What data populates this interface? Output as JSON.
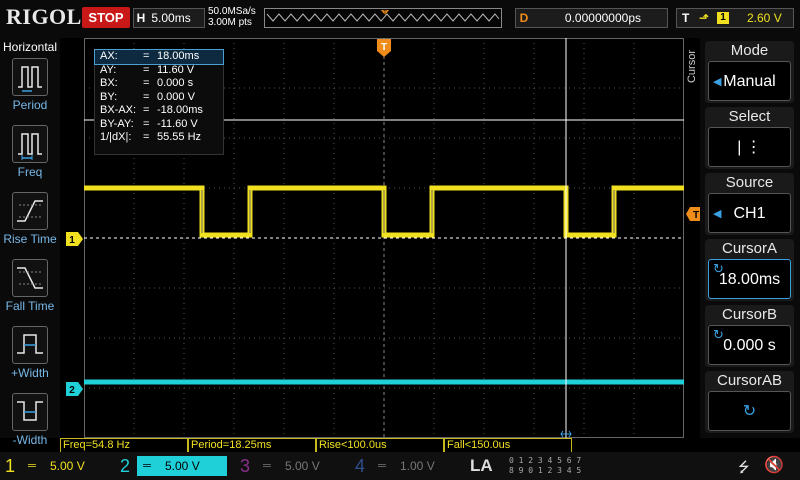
{
  "header": {
    "brand": "RIGOL",
    "run_state": "STOP",
    "timebase_label": "H",
    "timebase_value": "5.00ms",
    "sample_rate": "50.0MSa/s",
    "memory_depth": "3.00M pts",
    "delay_label": "D",
    "delay_value": "0.00000000ps",
    "trigger_label": "T",
    "trigger_edge": "⬏",
    "trigger_source": "1",
    "trigger_level": "2.60 V"
  },
  "left_panel": {
    "title": "Horizontal",
    "items": [
      {
        "label": "Period",
        "icon": "period-icon"
      },
      {
        "label": "Freq",
        "icon": "freq-icon"
      },
      {
        "label": "Rise Time",
        "icon": "rise-time-icon"
      },
      {
        "label": "Fall Time",
        "icon": "fall-time-icon"
      },
      {
        "label": "+Width",
        "icon": "pos-width-icon"
      },
      {
        "label": "-Width",
        "icon": "neg-width-icon"
      }
    ]
  },
  "cursor_readout": [
    {
      "key": "AX:",
      "value": "18.00ms",
      "selected": true
    },
    {
      "key": "AY:",
      "value": "11.60 V"
    },
    {
      "key": "BX:",
      "value": "0.000 s"
    },
    {
      "key": "BY:",
      "value": "0.000 V"
    },
    {
      "key": "BX-AX:",
      "value": "-18.00ms"
    },
    {
      "key": "BY-AY:",
      "value": "-11.60 V"
    },
    {
      "key": "1/|dX|:",
      "value": "55.55 Hz"
    }
  ],
  "cursor_readout_eq": "=",
  "markers": {
    "ch1": "1",
    "ch2": "2",
    "trigger_pos": "T",
    "trigger_level": "T"
  },
  "right_panel": {
    "menu_title": "Cursor",
    "buttons": [
      {
        "title": "Mode",
        "value": "Manual",
        "prefix": "◀"
      },
      {
        "title": "Select",
        "value": "|   ⋮",
        "prefix": ""
      },
      {
        "title": "Source",
        "value": "CH1",
        "prefix": "◀"
      },
      {
        "title": "CursorA",
        "value": "18.00ms",
        "prefix": "↻"
      },
      {
        "title": "CursorB",
        "value": "0.000 s",
        "prefix": "↻"
      },
      {
        "title": "CursorAB",
        "value": "↻",
        "prefix": ""
      }
    ]
  },
  "measurements": [
    {
      "text": "Freq=54.8 Hz"
    },
    {
      "text": "Period=18.25ms"
    },
    {
      "text": "Rise<100.0us"
    },
    {
      "text": "Fall<150.0us"
    }
  ],
  "channels": [
    {
      "num": "1",
      "coupling": "═",
      "scale": "5.00 V",
      "color": "#f0e020"
    },
    {
      "num": "2",
      "coupling": "═",
      "scale": "5.00 V",
      "color": "#20d0d8"
    },
    {
      "num": "3",
      "coupling": "═",
      "scale": "5.00 V",
      "color": "#d040d0"
    },
    {
      "num": "4",
      "coupling": "═",
      "scale": "1.00 V",
      "color": "#3070e0"
    }
  ],
  "la_label": "LA",
  "la_digits_top": "0 1 2 3  4 5 6 7",
  "la_digits_bot": "8 9 0 1  2 3 4 5",
  "colors": {
    "ch1": "#f0e020",
    "ch2": "#20d0d8",
    "trigger": "#f08c1a",
    "accent": "#3aa0e0",
    "stop": "#c81818"
  }
}
